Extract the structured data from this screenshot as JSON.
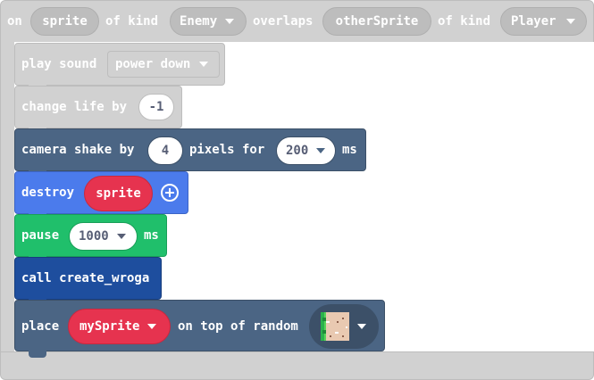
{
  "hat": {
    "word_on": "on",
    "sprite_var": "sprite",
    "word_of_kind_1": "of kind",
    "kind_1": "Enemy",
    "word_overlaps": "overlaps",
    "other_var": "otherSprite",
    "word_of_kind_2": "of kind",
    "kind_2": "Player"
  },
  "blocks": {
    "play_sound": {
      "label": "play sound",
      "value": "power down"
    },
    "change_life": {
      "label": "change life by",
      "value": "-1"
    },
    "camera_shake": {
      "label": "camera shake by",
      "amount": "4",
      "mid": "pixels for",
      "duration": "200",
      "unit": "ms"
    },
    "destroy": {
      "label": "destroy",
      "target": "sprite"
    },
    "pause": {
      "label": "pause",
      "duration": "1000",
      "unit": "ms"
    },
    "call": {
      "label": "call create_wroga"
    },
    "place": {
      "label": "place",
      "target": "mySprite",
      "mid": "on top of random"
    }
  },
  "colors": {
    "disabled_fill": "#D1D1D1",
    "disabled_border": "#BDBDBD",
    "scene": "#4B6584",
    "sprites": "#4B7BEC",
    "loops": "#20BF6B",
    "functions": "#1E4E9E",
    "variable": "#E6334F",
    "input_bg": "#FFFFFF"
  },
  "icons": {
    "dropdown": "caret-down-icon",
    "add": "plus-circle-icon",
    "tile": "tile-image-icon"
  }
}
